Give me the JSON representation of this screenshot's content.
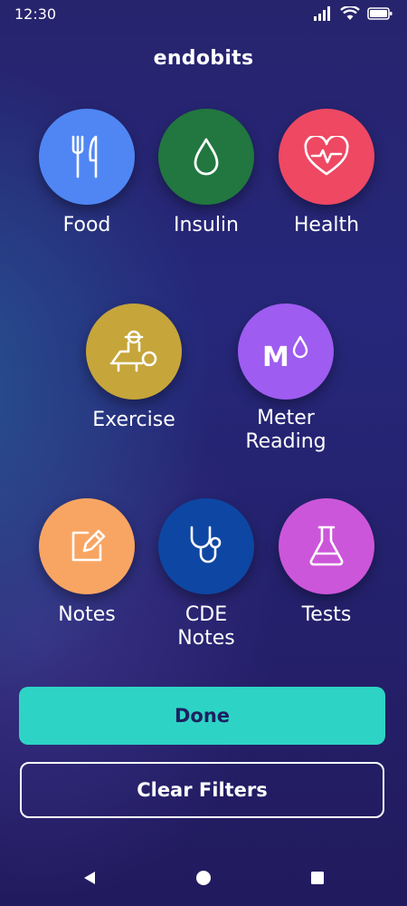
{
  "status": {
    "time": "12:30"
  },
  "app": {
    "title": "endobits"
  },
  "tiles": [
    {
      "label": "Food",
      "color": "#5086f3",
      "icon": "fork-knife-icon"
    },
    {
      "label": "Insulin",
      "color": "#21773f",
      "icon": "drop-icon"
    },
    {
      "label": "Health",
      "color": "#ee4863",
      "icon": "heart-pulse-icon"
    },
    {
      "label": "Exercise",
      "color": "#c6a53a",
      "icon": "weight-bench-icon"
    },
    {
      "label": "Meter\nReading",
      "color": "#9e5cf1",
      "icon": "meter-drop-icon",
      "icon_text": "M"
    },
    {
      "label": "Notes",
      "color": "#f8a563",
      "icon": "edit-note-icon"
    },
    {
      "label": "CDE\nNotes",
      "color": "#0e46a3",
      "icon": "stethoscope-icon"
    },
    {
      "label": "Tests",
      "color": "#cc56d9",
      "icon": "flask-icon"
    }
  ],
  "actions": {
    "done_label": "Done",
    "clear_label": "Clear Filters"
  },
  "colors": {
    "done_bg": "#2dd4c5",
    "done_text": "#1d2060"
  }
}
